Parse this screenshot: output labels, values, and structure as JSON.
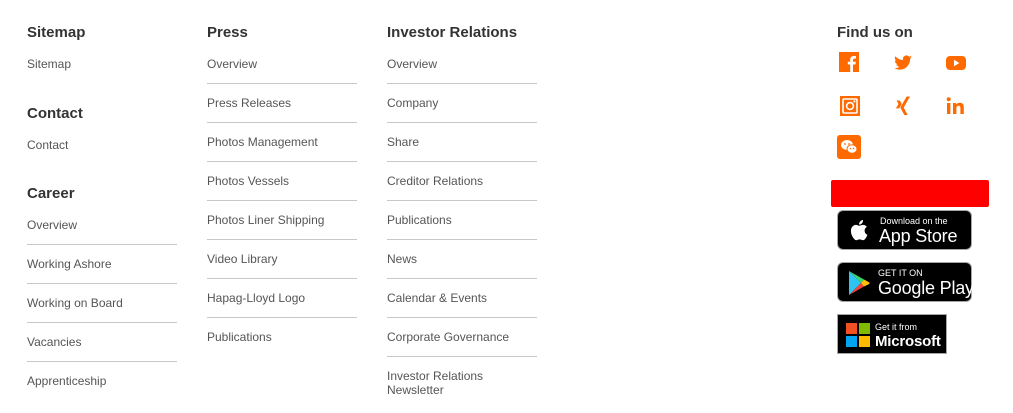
{
  "sitemap": {
    "heading": "Sitemap",
    "link": "Sitemap"
  },
  "contact": {
    "heading": "Contact",
    "link": "Contact"
  },
  "career": {
    "heading": "Career",
    "items": [
      "Overview",
      "Working Ashore",
      "Working on Board",
      "Vacancies",
      "Apprenticeship"
    ]
  },
  "press": {
    "heading": "Press",
    "items": [
      "Overview",
      "Press Releases",
      "Photos Management",
      "Photos Vessels",
      "Photos Liner Shipping",
      "Video Library",
      "Hapag-Lloyd Logo",
      "Publications"
    ]
  },
  "investor_relations": {
    "heading": "Investor Relations",
    "items": [
      "Overview",
      "Company",
      "Share",
      "Creditor Relations",
      "Publications",
      "News",
      "Calendar & Events",
      "Corporate Governance",
      "Investor Relations",
      "Newsletter"
    ]
  },
  "social": {
    "heading": "Find us on",
    "icons": [
      "facebook-icon",
      "twitter-icon",
      "youtube-icon",
      "instagram-icon",
      "xing-icon",
      "linkedin-icon",
      "wechat-icon"
    ],
    "accent_color": "#ff6a00"
  },
  "banner_color": "#ff0000",
  "app_badges": {
    "app_store": {
      "small": "Download on the",
      "big": "App Store"
    },
    "google_play": {
      "small": "GET IT ON",
      "big": "Google Play"
    },
    "microsoft": {
      "small": "Get it from",
      "big": "Microsoft"
    }
  }
}
